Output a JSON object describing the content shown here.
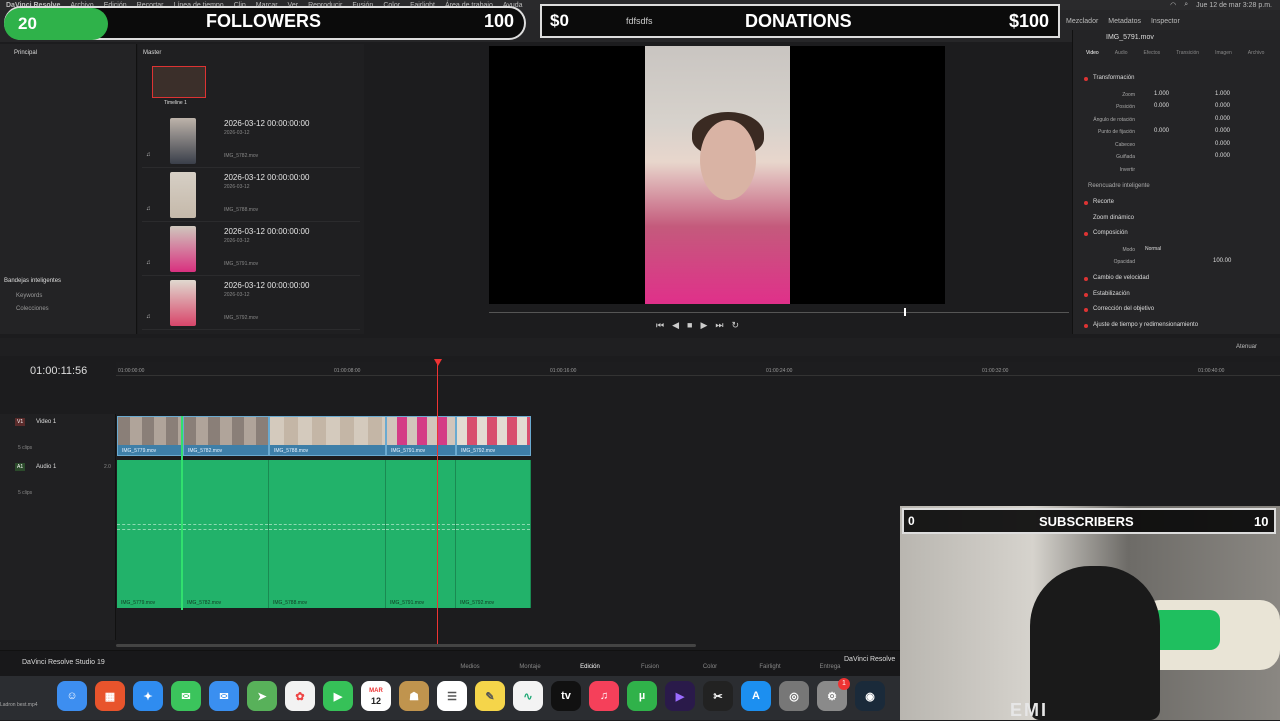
{
  "menubar": {
    "items": [
      "DaVinci Resolve",
      "Archivo",
      "Edición",
      "Recortar",
      "Línea de tiempo",
      "Clip",
      "Marcar",
      "Ver",
      "Reproducir",
      "Fusión",
      "Color",
      "Fairlight",
      "Área de trabajo",
      "Ayuda"
    ],
    "datetime": "Jue 12 de mar 3:28 p.m."
  },
  "overlays": {
    "followers": {
      "current": "20",
      "label": "FOLLOWERS",
      "goal": "100"
    },
    "donations": {
      "current": "$0",
      "handle": "fdfsdfs",
      "label": "DONATIONS",
      "goal": "$100"
    },
    "subscribers": {
      "current": "0",
      "label": "SUBSCRIBERS",
      "goal": "10"
    }
  },
  "toolbar": {
    "right_items": [
      "Mezclador",
      "Metadatos",
      "Inspector"
    ]
  },
  "media_pool": {
    "sidebar_title": "Principal",
    "smart_bins_title": "Bandejas inteligentes",
    "smart_bins": [
      "Keywords",
      "Colecciones"
    ],
    "list_title": "Master",
    "timeline_label": "Timeline 1",
    "clips": [
      {
        "date": "2026-03-12 00:00:00:00",
        "date2": "2026-03-12",
        "name": "IMG_5782.mov"
      },
      {
        "date": "2026-03-12 00:00:00:00",
        "date2": "2026-03-12",
        "name": "IMG_5788.mov"
      },
      {
        "date": "2026-03-12 00:00:00:00",
        "date2": "2026-03-12",
        "name": "IMG_5791.mov"
      },
      {
        "date": "2026-03-12 00:00:00:00",
        "date2": "2026-03-12",
        "name": "IMG_5792.mov"
      }
    ]
  },
  "inspector": {
    "clip_name": "IMG_5791.mov",
    "tabs": [
      "Video",
      "Audio",
      "Efectos",
      "Transición",
      "Imagen",
      "Archivo"
    ],
    "transform_title": "Transformación",
    "rows": [
      {
        "label": "Zoom",
        "x": "1.000",
        "y": "1.000"
      },
      {
        "label": "Posición",
        "x": "0.000",
        "y": "0.000"
      },
      {
        "label": "Ángulo de rotación",
        "x": "",
        "y": "0.000"
      },
      {
        "label": "Punto de fijación",
        "x": "0.000",
        "y": "0.000"
      },
      {
        "label": "Cabeceo",
        "x": "",
        "y": "0.000"
      },
      {
        "label": "Guiñada",
        "x": "",
        "y": "0.000"
      },
      {
        "label": "Invertir",
        "x": "",
        "y": ""
      }
    ],
    "smart_reframe": "Reencuadre inteligente",
    "crop": "Recorte",
    "dynamic_zoom": "Zoom dinámico",
    "composite": "Composición",
    "mode_label": "Modo",
    "mode_value": "Normal",
    "opacity_label": "Opacidad",
    "opacity_value": "100.00",
    "speed_change": "Cambio de velocidad",
    "stabilization": "Estabilización",
    "lens_correction": "Corrección del objetivo",
    "time_adjust": "Ajuste de tiempo y redimensionamiento"
  },
  "timeline": {
    "timecode": "01:00:11:56",
    "ruler": [
      "01:00:00:00",
      "01:00:08:00",
      "01:00:16:00",
      "01:00:24:00",
      "01:00:32:00",
      "01:00:40:00"
    ],
    "video_track": {
      "badge": "V1",
      "name": "Video 1",
      "count": "5 clips"
    },
    "audio_track": {
      "badge": "A1",
      "name": "Audio 1",
      "volume": "2.0",
      "count": "5 clips"
    },
    "clips": [
      "IMG_5779.mov",
      "IMG_5782.mov",
      "IMG_5788.mov",
      "IMG_5791.mov",
      "IMG_5792.mov"
    ],
    "volume_label": "Atenuar"
  },
  "pages": {
    "app": "DaVinci Resolve Studio 19",
    "tabs": [
      "Medios",
      "Montaje",
      "Edición",
      "Fusion",
      "Color",
      "Fairlight",
      "Entrega"
    ],
    "active": "Edición",
    "brand": "DaVinci Resolve"
  },
  "dock": {
    "calendar_month": "MAR",
    "calendar_day": "12",
    "badge": "1",
    "caption": "Ladron best.mp4"
  },
  "webcam": {
    "shirt_text": "EMI"
  }
}
